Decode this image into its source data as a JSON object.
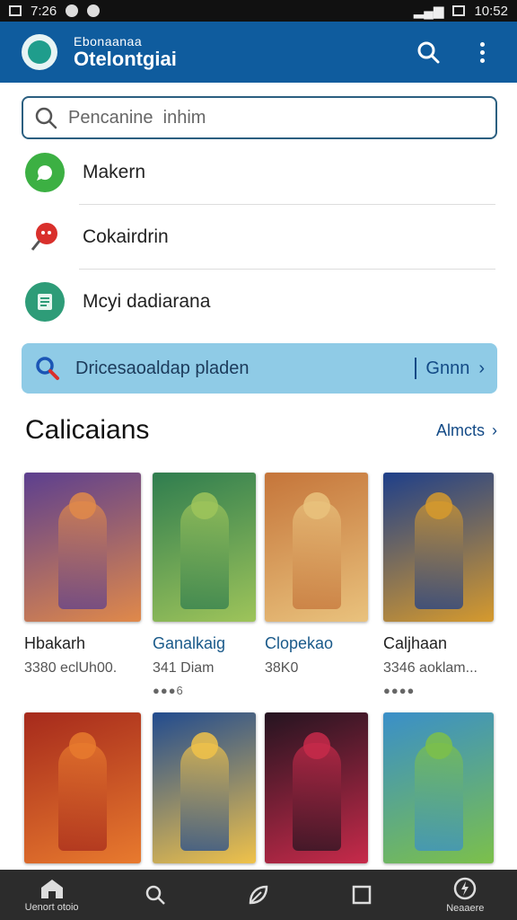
{
  "status_bar": {
    "left_text": "7:26",
    "time": "10:52"
  },
  "app": {
    "subtitle": "Ebonaanaa",
    "title": "Otelontgiai"
  },
  "search": {
    "placeholder": "Pencanine  inhim"
  },
  "menu_items": [
    {
      "label": "Makern",
      "icon": "chat-bubble-icon",
      "color": "#3cb043"
    },
    {
      "label": "Cokairdrin",
      "icon": "pin-icon",
      "color": "#d9302c"
    },
    {
      "label": "Mcyi dadiarana",
      "icon": "document-icon",
      "color": "#2e9c78"
    }
  ],
  "banner": {
    "text": "Dricesaoaldap pladen",
    "action": "Gnnn"
  },
  "section": {
    "title": "Calicaians",
    "more_label": "Almcts"
  },
  "cards": [
    {
      "name": "Hbakarh",
      "meta": "3380 eclUh00.",
      "dots": "",
      "style": "plain",
      "colors": [
        "#5c3f8f",
        "#e0894a"
      ]
    },
    {
      "name": "Ganalkaig",
      "meta": "341 Diam",
      "dots": "●●●6",
      "style": "link",
      "colors": [
        "#2f7d4f",
        "#9ec45a"
      ]
    },
    {
      "name": "Clopekao",
      "meta": "38K0",
      "dots": "",
      "style": "link",
      "colors": [
        "#c5753a",
        "#e9c27d"
      ]
    },
    {
      "name": "Caljhaan",
      "meta": "3346 aoklam...",
      "dots": "●●●●",
      "style": "plain",
      "colors": [
        "#1e3f8a",
        "#d69a2d"
      ]
    },
    {
      "name": "",
      "meta": "",
      "dots": "",
      "style": "plain",
      "colors": [
        "#a62a1c",
        "#e87a2e"
      ]
    },
    {
      "name": "",
      "meta": "",
      "dots": "",
      "style": "plain",
      "colors": [
        "#214b8f",
        "#f0c24a"
      ]
    },
    {
      "name": "",
      "meta": "",
      "dots": "",
      "style": "plain",
      "colors": [
        "#241420",
        "#c72a4a"
      ]
    },
    {
      "name": "",
      "meta": "",
      "dots": "",
      "style": "plain",
      "colors": [
        "#3a8fc9",
        "#7cc04a"
      ]
    }
  ],
  "bottom_nav": [
    {
      "label": "Uenort otoio",
      "icon": "home-icon"
    },
    {
      "label": "",
      "icon": "search-icon"
    },
    {
      "label": "",
      "icon": "leaf-icon"
    },
    {
      "label": "",
      "icon": "square-icon"
    },
    {
      "label": "Neaaere",
      "icon": "power-icon"
    }
  ],
  "colors": {
    "app_bar": "#0f5c9e",
    "banner": "#8fcbe6",
    "link": "#134a86",
    "bottom_nav": "#2c2c2c"
  }
}
